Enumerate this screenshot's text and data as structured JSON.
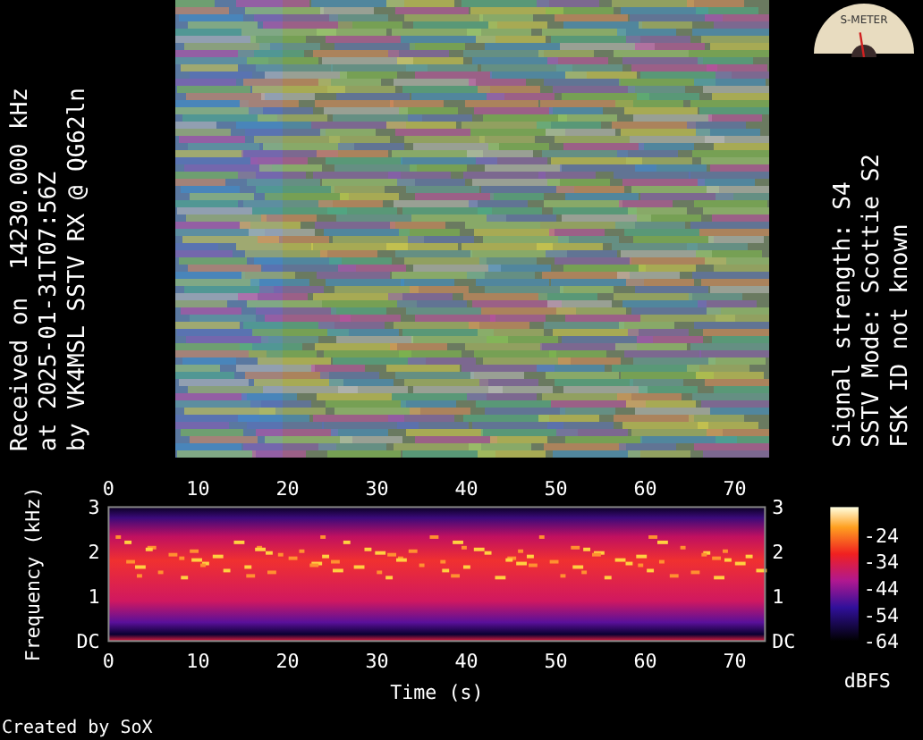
{
  "reception_info": [
    "Received on  14230.000 kHz",
    "at 2025-01-31T07:56Z",
    "by VK4MSL SSTV RX @ QG62ln"
  ],
  "s_meter": {
    "label": "S-METER",
    "level": 0.45
  },
  "signal_info": [
    "Signal strength: S4",
    "SSTV Mode: Scottie S2",
    "FSK ID not known"
  ],
  "spectrogram": {
    "top_x_ticks": [
      "0",
      "10",
      "20",
      "30",
      "40",
      "50",
      "60",
      "70"
    ],
    "left_y_ticks": [
      "3",
      "2",
      "1",
      "DC"
    ],
    "right_y_ticks": [
      "3",
      "2",
      "1",
      "DC"
    ],
    "bottom_x_ticks": [
      "0",
      "10",
      "20",
      "30",
      "40",
      "50",
      "60",
      "70"
    ],
    "xlabel": "Time (s)",
    "ylabel": "Frequency (kHz)",
    "colorbar_ticks": [
      "-24",
      "-34",
      "-44",
      "-54",
      "-64"
    ],
    "colorbar_label": "dBFS"
  },
  "footer": "Created by SoX"
}
